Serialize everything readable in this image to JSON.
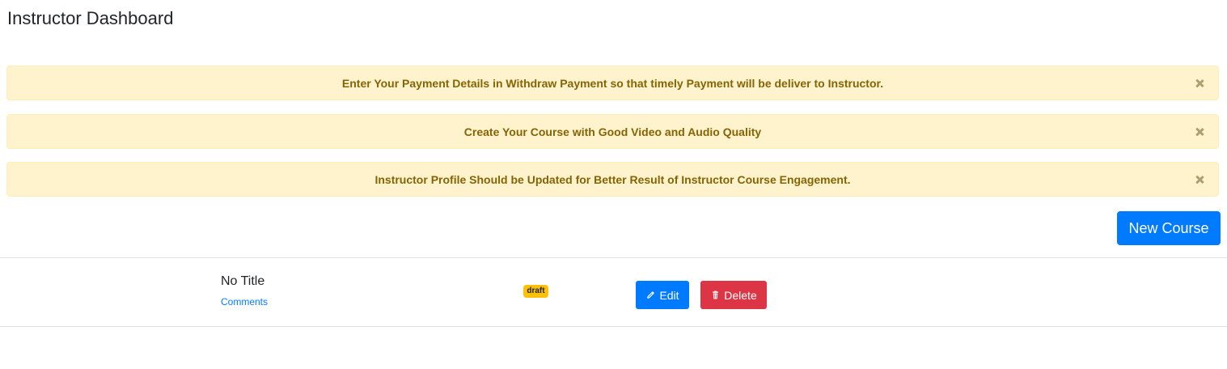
{
  "page": {
    "title": "Instructor Dashboard"
  },
  "alerts": [
    {
      "text": "Enter Your Payment Details in Withdraw Payment so that timely Payment will be deliver to Instructor.",
      "close_icon": "close-icon"
    },
    {
      "text": "Create Your Course with Good Video and Audio Quality",
      "close_icon": "close-icon"
    },
    {
      "text": "Instructor Profile Should be Updated for Better Result of Instructor Course Engagement.",
      "close_icon": "close-icon"
    }
  ],
  "actions": {
    "new_course_label": "New Course"
  },
  "courses": [
    {
      "title": "No Title",
      "comments_label": "Comments",
      "status": "draft",
      "edit_label": "Edit",
      "edit_icon": "pencil-icon",
      "delete_label": "Delete",
      "delete_icon": "trash-icon"
    }
  ],
  "colors": {
    "primary": "#007bff",
    "danger": "#dc3545",
    "warning": "#ffc107",
    "alert_bg": "#fff3cd",
    "alert_text": "#856404"
  }
}
